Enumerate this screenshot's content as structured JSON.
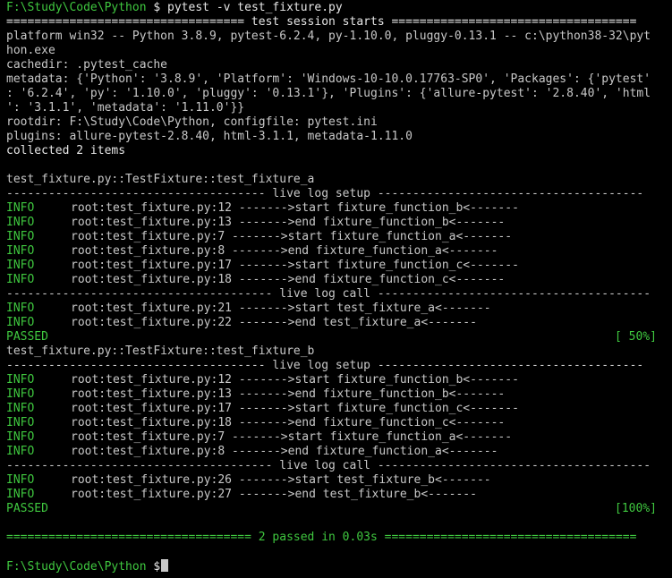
{
  "prompt": {
    "path": "F:\\Study\\Code\\Python",
    "symbol": "$",
    "command": "pytest -v test_fixture.py"
  },
  "session": {
    "header": "================================== test session starts ===================================",
    "platform_1": "platform win32 -- Python 3.8.9, pytest-6.2.4, py-1.10.0, pluggy-0.13.1 -- c:\\python38-32\\pyt",
    "platform_2": "hon.exe",
    "cachedir": "cachedir: .pytest_cache",
    "metadata_1": "metadata: {'Python': '3.8.9', 'Platform': 'Windows-10-10.0.17763-SP0', 'Packages': {'pytest'",
    "metadata_2": ": '6.2.4', 'py': '1.10.0', 'pluggy': '0.13.1'}, 'Plugins': {'allure-pytest': '2.8.40', 'html",
    "metadata_3": "': '3.1.1', 'metadata': '1.11.0'}}",
    "rootdir": "rootdir: F:\\Study\\Code\\Python, configfile: pytest.ini",
    "plugins": "plugins: allure-pytest-2.8.40, html-3.1.1, metadata-1.11.0",
    "collected": "collected 2 items"
  },
  "tests": [
    {
      "name": "test_fixture.py::TestFixture::test_fixture_a",
      "setup_header": "------------------------------------- live log setup --------------------------------------",
      "setup_logs": [
        {
          "level": "INFO",
          "msg": "root:test_fixture.py:12 ------->start fixture_function_b<-------"
        },
        {
          "level": "INFO",
          "msg": "root:test_fixture.py:13 ------->end fixture_function_b<-------"
        },
        {
          "level": "INFO",
          "msg": "root:test_fixture.py:7 ------->start fixture_function_a<-------"
        },
        {
          "level": "INFO",
          "msg": "root:test_fixture.py:8 ------->end fixture_function_a<-------"
        },
        {
          "level": "INFO",
          "msg": "root:test_fixture.py:17 ------->start fixture_function_c<-------"
        },
        {
          "level": "INFO",
          "msg": "root:test_fixture.py:18 ------->end fixture_function_c<-------"
        }
      ],
      "call_header": "-------------------------------------- live log call ---------------------------------------",
      "call_logs": [
        {
          "level": "INFO",
          "msg": "root:test_fixture.py:21 ------->start test_fixture_a<-------"
        },
        {
          "level": "INFO",
          "msg": "root:test_fixture.py:22 ------->end test_fixture_a<-------"
        }
      ],
      "result": "PASSED",
      "progress": "[ 50%]"
    },
    {
      "name": "test_fixture.py::TestFixture::test_fixture_b",
      "setup_header": "------------------------------------- live log setup --------------------------------------",
      "setup_logs": [
        {
          "level": "INFO",
          "msg": "root:test_fixture.py:12 ------->start fixture_function_b<-------"
        },
        {
          "level": "INFO",
          "msg": "root:test_fixture.py:13 ------->end fixture_function_b<-------"
        },
        {
          "level": "INFO",
          "msg": "root:test_fixture.py:17 ------->start fixture_function_c<-------"
        },
        {
          "level": "INFO",
          "msg": "root:test_fixture.py:18 ------->end fixture_function_c<-------"
        },
        {
          "level": "INFO",
          "msg": "root:test_fixture.py:7 ------->start fixture_function_a<-------"
        },
        {
          "level": "INFO",
          "msg": "root:test_fixture.py:8 ------->end fixture_function_a<-------"
        }
      ],
      "call_header": "-------------------------------------- live log call ---------------------------------------",
      "call_logs": [
        {
          "level": "INFO",
          "msg": "root:test_fixture.py:26 ------->start test_fixture_b<-------"
        },
        {
          "level": "INFO",
          "msg": "root:test_fixture.py:27 ------->end test_fixture_b<-------"
        }
      ],
      "result": "PASSED",
      "progress": "[100%]"
    }
  ],
  "summary": "=================================== 2 passed in 0.03s ====================================",
  "colors": {
    "background": "#000000",
    "text": "#c8c8c8",
    "success_green": "#3fc73f"
  }
}
